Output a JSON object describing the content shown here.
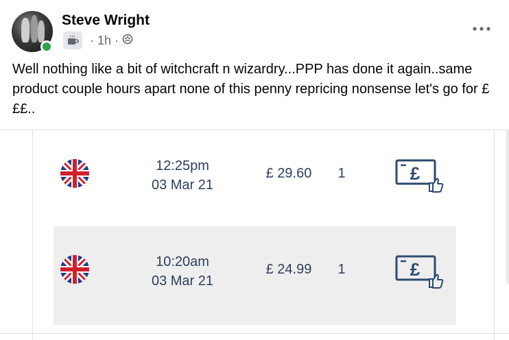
{
  "post": {
    "author": "Steve Wright",
    "time": "1h",
    "separator": "·",
    "privacy_icon": "group-icon",
    "badge_icon": "coffee-mug-icon",
    "more_icon": "more-options-icon",
    "text": "Well nothing like a bit of witchcraft n wizardry...PPP has done it again..same product couple hours apart none of this penny repricing nonsense let's go for £££.."
  },
  "orders": [
    {
      "flag_icon": "uk-flag-icon",
      "time": "12:25pm",
      "date": "03 Mar 21",
      "price": "£ 29.60",
      "qty": "1",
      "action_icon": "pound-thumbs-up-icon"
    },
    {
      "flag_icon": "uk-flag-icon",
      "time": "10:20am",
      "date": "03 Mar 21",
      "price": "£ 24.99",
      "qty": "1",
      "action_icon": "pound-thumbs-up-icon"
    }
  ],
  "colors": {
    "text_primary": "#050505",
    "text_secondary": "#65676b",
    "table_text": "#2c3e5c",
    "online": "#31a24c",
    "row_alt_bg": "#eeeeee"
  }
}
